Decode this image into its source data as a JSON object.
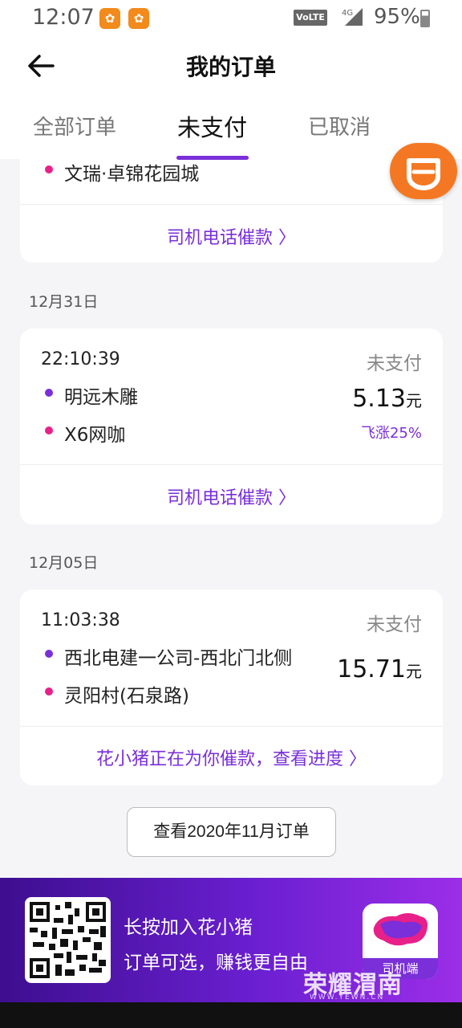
{
  "status_bar": {
    "time": "12:07",
    "app_icon_1": "uc",
    "app_icon_2": "uc",
    "volte": "VoLTE",
    "network": "4G",
    "battery": "95%"
  },
  "header": {
    "title": "我的订单",
    "back_icon": "arrow-left-icon"
  },
  "tabs": [
    {
      "label": "全部订单",
      "active": false
    },
    {
      "label": "未支付",
      "active": true
    },
    {
      "label": "已取消",
      "active": false
    }
  ],
  "accent_color": "#7a2fd8",
  "partial_order": {
    "end": "文瑞·卓锦花园城",
    "action": "司机电话催款 〉"
  },
  "orders": [
    {
      "date": "12月31日",
      "time": "22:10:39",
      "status": "未支付",
      "start": "明远木雕",
      "end": "X6网咖",
      "price": "5.13",
      "unit": "元",
      "surge": "飞涨25%",
      "action": "司机电话催款 〉"
    },
    {
      "date": "12月05日",
      "time": "11:03:38",
      "status": "未支付",
      "start": "西北电建一公司-西北门北侧",
      "end": "灵阳村(石泉路)",
      "price": "15.71",
      "unit": "元",
      "action": "花小猪正在为你催款，查看进度 〉"
    }
  ],
  "more_button": "查看2020年11月订单",
  "banner": {
    "line1": "长按加入花小猪",
    "line2": "订单可选，赚钱更自由",
    "app_label": "司机端",
    "watermark": "荣耀渭南",
    "watermark_sub": "WWW.YEWN.CN"
  }
}
